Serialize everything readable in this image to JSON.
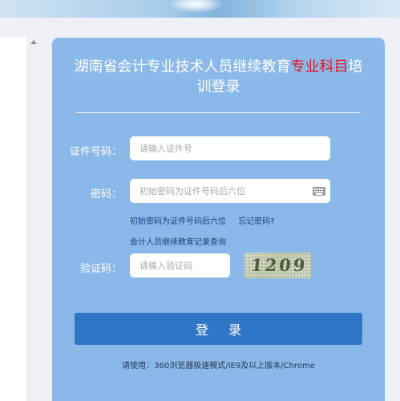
{
  "login": {
    "title_part1": "湖南省会计专业技术人员继续教育",
    "title_highlight": "专业科目",
    "title_part2": "培训登录",
    "id_label": "证件号码：",
    "id_placeholder": "请输入证件号",
    "password_label": "密码：",
    "password_placeholder": "初始密码为证件号码后六位",
    "password_hint": "初始密码为证件号码后六位",
    "forgot_password": "忘记密码?",
    "record_query": "会计人员继续教育记录查询",
    "captcha_label": "验证码：",
    "captcha_placeholder": "请输入验证码",
    "captcha_value": "1209",
    "login_button": "登 录",
    "browser_note": "请使用：360浏览器极速模式/IE9及以上版本/Chrome"
  },
  "colors": {
    "card_bg": "#8ab8e8",
    "button_bg": "#2f77c6",
    "highlight": "#e8141e",
    "link": "#1c3d85"
  },
  "icons": {
    "keyboard": "keyboard-icon",
    "scroll_up": "scroll-up-arrow-icon"
  }
}
